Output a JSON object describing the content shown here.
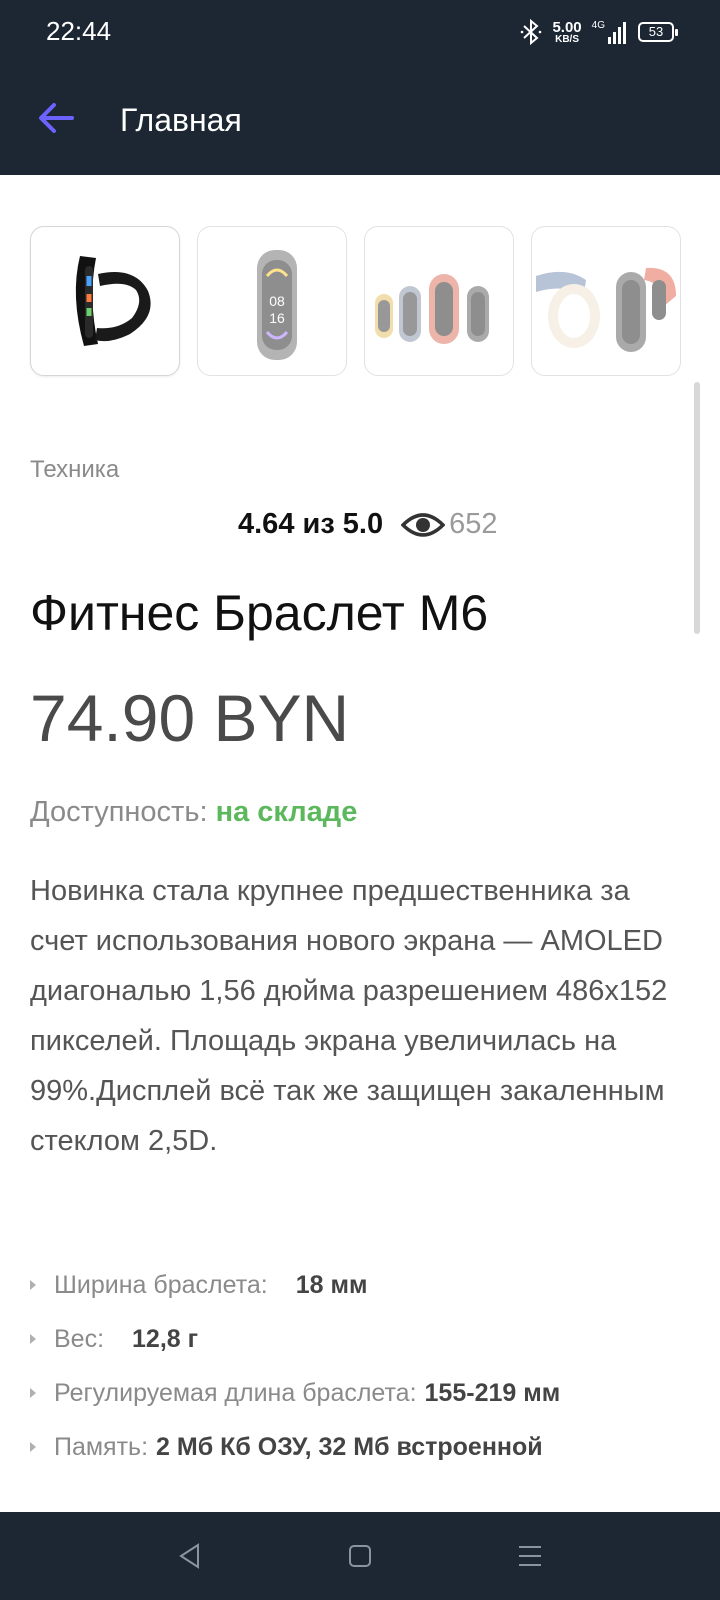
{
  "status_bar": {
    "time": "22:44",
    "speed_value": "5.00",
    "speed_unit": "KB/S",
    "network": "4G",
    "battery": "53"
  },
  "app_bar": {
    "title": "Главная",
    "back_icon": "arrow-left-icon"
  },
  "colors": {
    "app_bar_bg": "#1c2733",
    "back_arrow": "#6c63ff",
    "in_stock": "#5cb85c"
  },
  "product": {
    "category": "Техника",
    "rating": "4.64 из 5.0",
    "views": "652",
    "title": "Фитнес Браслет M6",
    "price": "74.90 BYN",
    "availability_label": "Доступность:",
    "availability_value": "на складе",
    "description": "Новинка стала крупнее предшественника за счет использования нового экрана — AMOLED диагональю 1,56 дюйма разрешением 486x152 пикселей. Площадь экрана увеличилась на 99%.Дисплей всё так же защищен закаленным стеклом 2,5D.",
    "thumbnail_screen_texts": [
      "08",
      "16"
    ],
    "specs": [
      {
        "label": "Ширина браслета:",
        "value": "18 мм"
      },
      {
        "label": "Вес:",
        "value": "12,8 г"
      },
      {
        "label": "Регулируемая длина браслета:",
        "value": "155-219 мм"
      },
      {
        "label": "Память:",
        "value": "2 Мб Кб ОЗУ, 32 Мб встроенной"
      }
    ]
  },
  "nav_bar": {
    "back": "triangle-back-icon",
    "home": "square-home-icon",
    "menu": "menu-icon"
  }
}
